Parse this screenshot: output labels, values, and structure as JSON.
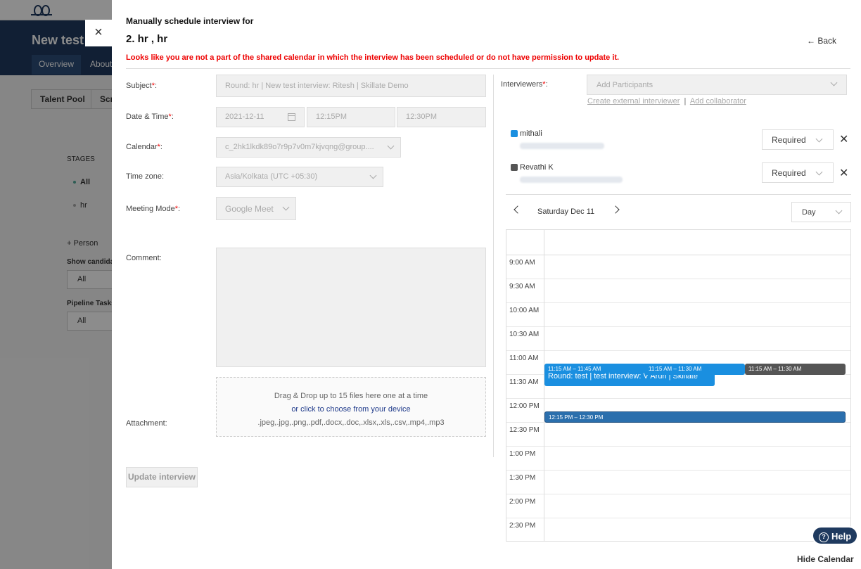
{
  "background": {
    "app_title": "New test",
    "tabs": [
      "Overview",
      "About"
    ],
    "pills": [
      "Talent Pool",
      "Scr"
    ],
    "stages_label": "STAGES",
    "stage_items": [
      "All",
      "hr"
    ],
    "personal_label": "+   Person",
    "show_candidates_label": "Show candidat",
    "show_candidates_value": "All",
    "pipeline_tasks_label": "Pipeline Tasks",
    "pipeline_tasks_value": "All"
  },
  "modal": {
    "close_icon": "×",
    "heading": "Manually schedule interview for",
    "title": "2. hr , hr",
    "back_label": "← Back",
    "warning": "Looks like you are not a part of the shared calendar in which the interview has been scheduled or do not have permission to update it.",
    "form": {
      "subject_label": "Subject",
      "subject_value": "Round: hr | New test interview: Ritesh | Skillate Demo",
      "datetime_label": "Date & Time",
      "date_value": "2021-12-11",
      "start_time": "12:15PM",
      "end_time": "12:30PM",
      "calendar_label": "Calendar",
      "calendar_value": "c_2hk1lkdk89o7r9p7v0m7kjvqng@group....",
      "timezone_label": "Time zone:",
      "timezone_value": "Asia/Kolkata (UTC +05:30)",
      "meeting_mode_label": "Meeting Mode",
      "meeting_mode_value": "Google Meet",
      "comment_label": "Comment:",
      "attachment_label": "Attachment:",
      "drop_line1": "Drag & Drop up to 15 files here one at a time",
      "drop_line2": "or click to choose from your device",
      "drop_line3": ".jpeg,.jpg,.png,.pdf,.docx,.doc,.xlsx,.xls,.csv,.mp4,.mp3",
      "update_button": "Update interview"
    },
    "interviewers": {
      "label": "Interviewers",
      "placeholder": "Add Participants",
      "create_external": "Create external interviewer",
      "separator": "|",
      "add_collaborator": "Add collaborator",
      "participants": [
        {
          "name": "mithali",
          "color": "#1a8fe0",
          "requirement": "Required"
        },
        {
          "name": "Revathi K",
          "color": "#555555",
          "requirement": "Required"
        }
      ],
      "remove_icon": "✕"
    },
    "calendar": {
      "date_label": "Saturday Dec 11",
      "view": "Day",
      "time_slots": [
        "9:00 AM",
        "9:30 AM",
        "10:00 AM",
        "10:30 AM",
        "11:00 AM",
        "11:30 AM",
        "12:00 PM",
        "12:30 PM",
        "1:00 PM",
        "1:30 PM",
        "2:00 PM",
        "2:30 PM"
      ],
      "events": [
        {
          "time": "11:15 AM – 11:45 AM",
          "title": "Round: test | test interview: V Arun | Skillate",
          "color": "#1a8fe0"
        },
        {
          "time": "11:15 AM – 11:30 AM",
          "title": "",
          "color": "#1a8fe0"
        },
        {
          "time": "11:15 AM – 11:30 AM",
          "title": "",
          "color": "#555555"
        },
        {
          "time": "12:15 PM – 12:30 PM",
          "title": "",
          "color": "#2b6fad"
        }
      ]
    },
    "help_label": "Help",
    "hide_calendar": "Hide Calendar"
  }
}
